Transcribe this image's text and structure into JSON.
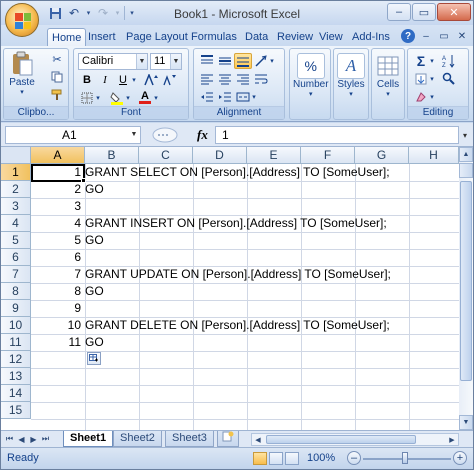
{
  "window": {
    "title": "Book1 - Microsoft Excel"
  },
  "ribbon": {
    "tabs": [
      {
        "label": "Home",
        "active": true
      },
      {
        "label": "Insert"
      },
      {
        "label": "Page Layout"
      },
      {
        "label": "Formulas"
      },
      {
        "label": "Data"
      },
      {
        "label": "Review"
      },
      {
        "label": "View"
      },
      {
        "label": "Add-Ins"
      }
    ],
    "groups": {
      "clipboard": "Clipbo...",
      "font": "Font",
      "alignment": "Alignment",
      "editing": "Editing"
    },
    "paste_label": "Paste",
    "font_name": "Calibri",
    "font_size": "11",
    "number_label": "Number",
    "styles_label": "Styles",
    "cells_label": "Cells",
    "number_icon": "%",
    "bold": "B",
    "italic": "I",
    "underline": "U",
    "font_color_glyph": "A",
    "styles_glyph": "A",
    "sigma": "Σ",
    "fx_label": "fx"
  },
  "formula_bar": {
    "name_box": "A1",
    "formula": "1"
  },
  "columns": [
    "A",
    "B",
    "C",
    "D",
    "E",
    "F",
    "G",
    "H"
  ],
  "rows": [
    "1",
    "2",
    "3",
    "4",
    "5",
    "6",
    "7",
    "8",
    "9",
    "10",
    "11",
    "12",
    "13",
    "14",
    "15"
  ],
  "cells": {
    "a": [
      "1",
      "2",
      "3",
      "4",
      "5",
      "6",
      "7",
      "8",
      "9",
      "10",
      "11"
    ],
    "b1": "GRANT SELECT ON [Person].[Address] TO [SomeUser];",
    "b2": "GO",
    "b4": "GRANT INSERT ON [Person].[Address] TO [SomeUser];",
    "b5": "GO",
    "b7": "GRANT UPDATE ON [Person].[Address] TO [SomeUser];",
    "b8": "GO",
    "b10": "GRANT DELETE ON [Person].[Address] TO [SomeUser];",
    "b11": "GO"
  },
  "sheets": [
    "Sheet1",
    "Sheet2",
    "Sheet3"
  ],
  "status": {
    "text": "Ready",
    "zoom": "100%"
  },
  "colors": {
    "accent": "#15428b",
    "selection": "#f1c15f"
  }
}
